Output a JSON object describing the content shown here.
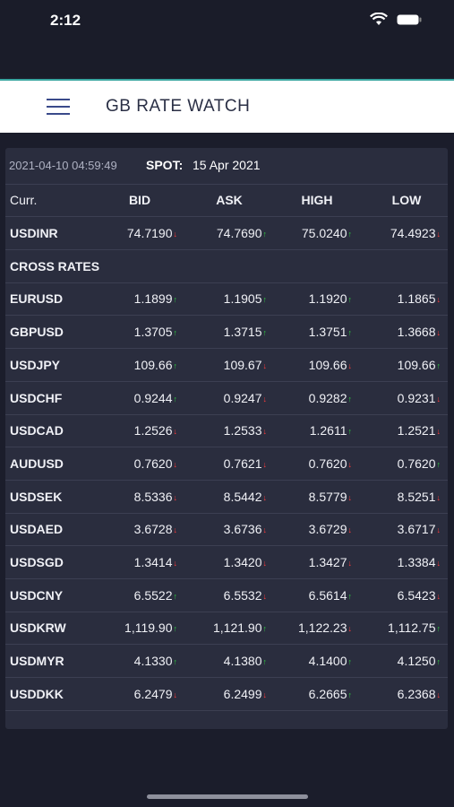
{
  "status_bar": {
    "time": "2:12"
  },
  "header": {
    "title": "GB RATE WATCH"
  },
  "meta": {
    "timestamp": "2021-04-10 04:59:49",
    "spot_label": "SPOT:",
    "spot_value": "15 Apr 2021"
  },
  "columns": [
    "Curr.",
    "BID",
    "ASK",
    "HIGH",
    "LOW"
  ],
  "section_label": "CROSS RATES",
  "colors": {
    "up": "#2ecc40",
    "down": "#ff3b3b",
    "background": "#1b1d2b",
    "card": "#2a2d3e"
  },
  "rows": [
    {
      "curr": "USDINR",
      "bid": "74.7190",
      "bid_dir": "down",
      "ask": "74.7690",
      "ask_dir": "up",
      "high": "75.0240",
      "high_dir": "up",
      "low": "74.4923",
      "low_dir": "down"
    },
    {
      "section": true
    },
    {
      "curr": "EURUSD",
      "bid": "1.1899",
      "bid_dir": "up",
      "ask": "1.1905",
      "ask_dir": "up",
      "high": "1.1920",
      "high_dir": "up",
      "low": "1.1865",
      "low_dir": "down"
    },
    {
      "curr": "GBPUSD",
      "bid": "1.3705",
      "bid_dir": "up",
      "ask": "1.3715",
      "ask_dir": "up",
      "high": "1.3751",
      "high_dir": "up",
      "low": "1.3668",
      "low_dir": "down"
    },
    {
      "curr": "USDJPY",
      "bid": "109.66",
      "bid_dir": "up",
      "ask": "109.67",
      "ask_dir": "down",
      "high": "109.66",
      "high_dir": "down",
      "low": "109.66",
      "low_dir": "up"
    },
    {
      "curr": "USDCHF",
      "bid": "0.9244",
      "bid_dir": "up",
      "ask": "0.9247",
      "ask_dir": "down",
      "high": "0.9282",
      "high_dir": "up",
      "low": "0.9231",
      "low_dir": "down"
    },
    {
      "curr": "USDCAD",
      "bid": "1.2526",
      "bid_dir": "down",
      "ask": "1.2533",
      "ask_dir": "down",
      "high": "1.2611",
      "high_dir": "up",
      "low": "1.2521",
      "low_dir": "down"
    },
    {
      "curr": "AUDUSD",
      "bid": "0.7620",
      "bid_dir": "down",
      "ask": "0.7621",
      "ask_dir": "down",
      "high": "0.7620",
      "high_dir": "down",
      "low": "0.7620",
      "low_dir": "up"
    },
    {
      "curr": "USDSEK",
      "bid": "8.5336",
      "bid_dir": "down",
      "ask": "8.5442",
      "ask_dir": "down",
      "high": "8.5779",
      "high_dir": "down",
      "low": "8.5251",
      "low_dir": "down"
    },
    {
      "curr": "USDAED",
      "bid": "3.6728",
      "bid_dir": "down",
      "ask": "3.6736",
      "ask_dir": "down",
      "high": "3.6729",
      "high_dir": "down",
      "low": "3.6717",
      "low_dir": "down"
    },
    {
      "curr": "USDSGD",
      "bid": "1.3414",
      "bid_dir": "down",
      "ask": "1.3420",
      "ask_dir": "down",
      "high": "1.3427",
      "high_dir": "down",
      "low": "1.3384",
      "low_dir": "down"
    },
    {
      "curr": "USDCNY",
      "bid": "6.5522",
      "bid_dir": "up",
      "ask": "6.5532",
      "ask_dir": "down",
      "high": "6.5614",
      "high_dir": "up",
      "low": "6.5423",
      "low_dir": "down"
    },
    {
      "curr": "USDKRW",
      "bid": "1,119.90",
      "bid_dir": "up",
      "ask": "1,121.90",
      "ask_dir": "up",
      "high": "1,122.23",
      "high_dir": "down",
      "low": "1,112.75",
      "low_dir": "up"
    },
    {
      "curr": "USDMYR",
      "bid": "4.1330",
      "bid_dir": "up",
      "ask": "4.1380",
      "ask_dir": "up",
      "high": "4.1400",
      "high_dir": "up",
      "low": "4.1250",
      "low_dir": "up"
    },
    {
      "curr": "USDDKK",
      "bid": "6.2479",
      "bid_dir": "down",
      "ask": "6.2499",
      "ask_dir": "down",
      "high": "6.2665",
      "high_dir": "up",
      "low": "6.2368",
      "low_dir": "down"
    }
  ]
}
